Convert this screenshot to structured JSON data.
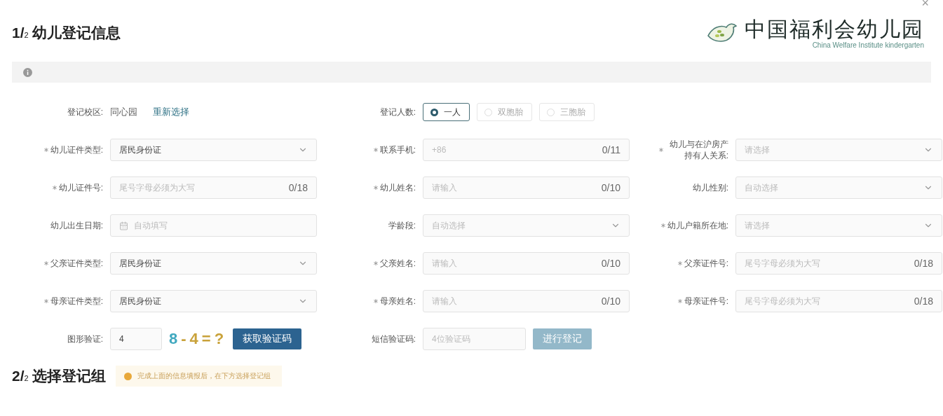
{
  "header": {
    "title": "1/$_{2}$ 幼儿登记信息",
    "close": "×"
  },
  "logo": {
    "name_cn": "中国福利会幼儿园",
    "name_en": "China Welfare Institute kindergarten"
  },
  "campus": {
    "label": "登记校区:",
    "value": "同心园",
    "link": "重新选择"
  },
  "count": {
    "label": "登记人数:",
    "options": [
      {
        "label": "一人",
        "selected": true
      },
      {
        "label": "双胞胎",
        "selected": false
      },
      {
        "label": "三胞胎",
        "selected": false
      }
    ]
  },
  "fields": [
    {
      "label": "幼儿证件类型:",
      "required": true,
      "kind": "select",
      "value": "居民身份证"
    },
    {
      "label": "联系手机:",
      "required": true,
      "kind": "input",
      "placeholder": "+86",
      "counter": "0/11"
    },
    {
      "label": "幼儿与在沪房产持有人关系:",
      "required": true,
      "kind": "select",
      "placeholder": "请选择"
    },
    {
      "label": "幼儿证件号:",
      "required": true,
      "kind": "input",
      "placeholder": "尾号字母必须为大写",
      "counter": "0/18"
    },
    {
      "label": "幼儿姓名:",
      "required": true,
      "kind": "input",
      "placeholder": "请输入",
      "counter": "0/10"
    },
    {
      "label": "幼儿性别:",
      "required": false,
      "kind": "select",
      "placeholder": "自动选择"
    },
    {
      "label": "幼儿出生日期:",
      "required": false,
      "kind": "date",
      "placeholder": "自动填写"
    },
    {
      "label": "学龄段:",
      "required": false,
      "kind": "select",
      "placeholder": "自动选择"
    },
    {
      "label": "幼儿户籍所在地:",
      "required": true,
      "kind": "select",
      "placeholder": "请选择"
    },
    {
      "label": "父亲证件类型:",
      "required": true,
      "kind": "select",
      "value": "居民身份证"
    },
    {
      "label": "父亲姓名:",
      "required": true,
      "kind": "input",
      "placeholder": "请输入",
      "counter": "0/10"
    },
    {
      "label": "父亲证件号:",
      "required": true,
      "kind": "input",
      "placeholder": "尾号字母必须为大写",
      "counter": "0/18"
    },
    {
      "label": "母亲证件类型:",
      "required": true,
      "kind": "select",
      "value": "居民身份证"
    },
    {
      "label": "母亲姓名:",
      "required": true,
      "kind": "input",
      "placeholder": "请输入",
      "counter": "0/10"
    },
    {
      "label": "母亲证件号:",
      "required": true,
      "kind": "input",
      "placeholder": "尾号字母必须为大写",
      "counter": "0/18"
    }
  ],
  "captcha": {
    "label": "图形验证:",
    "value": "4",
    "image_text": "8-4=?",
    "button": "获取验证码"
  },
  "sms": {
    "label": "短信验证码:",
    "placeholder": "4位验证码",
    "button": "进行登记",
    "disabled": true
  },
  "section2": {
    "title": "2/$_{2}$ 选择登记组",
    "notice": "完成上面的信息填报后，在下方选择登记组"
  }
}
